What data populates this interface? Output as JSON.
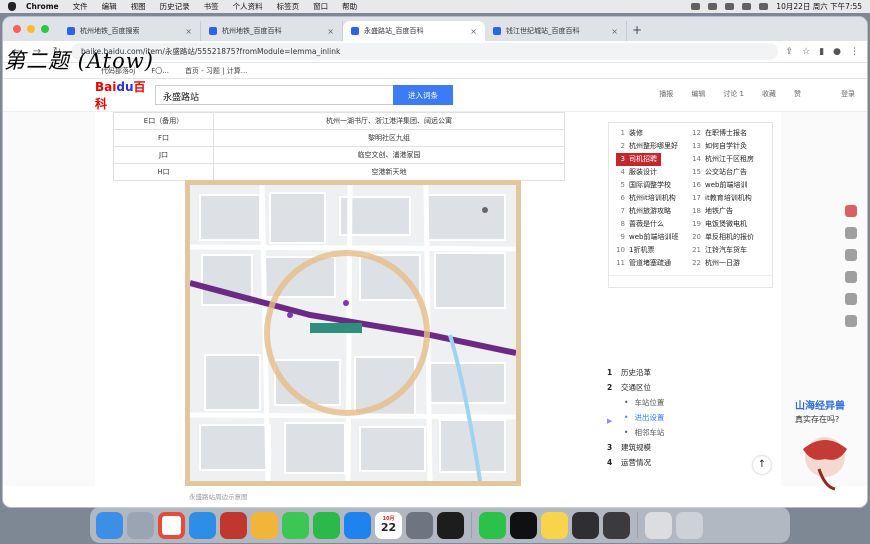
{
  "menubar": {
    "app": "Chrome",
    "items": [
      "文件",
      "编辑",
      "视图",
      "历史记录",
      "书签",
      "个人资料",
      "标签页",
      "窗口",
      "帮助"
    ],
    "clock": "10月22日 周六 下午7:55"
  },
  "tabs": [
    {
      "title": "杭州地铁_百度搜索",
      "active": false
    },
    {
      "title": "杭州地铁_百度百科",
      "active": false
    },
    {
      "title": "永盛路站_百度百科",
      "active": true
    },
    {
      "title": "钱江世纪城站_百度百科",
      "active": false
    }
  ],
  "address": {
    "url": "baike.baidu.com/item/永盛路站/55521875?fromModule=lemma_inlink"
  },
  "bookmarks": [
    "代码部落oj",
    "F〇...",
    "首页 - 习题 | 计算..."
  ],
  "overlay_note": "第二题 (Atow)",
  "baike": {
    "logo": {
      "part1": "Bai",
      "part2": "du",
      "part3": "百科"
    },
    "search_value": "永盛路站",
    "search_button": "进入词条",
    "actions": [
      "播报",
      "编辑",
      "讨论 1",
      "收藏",
      "赞"
    ],
    "login": "登录"
  },
  "exits_table": [
    {
      "exit": "E口（备用）",
      "destination": "杭州一湖书厅、浙江港洋集团、阔远公寓"
    },
    {
      "exit": "F口",
      "destination": "黎明社区九组"
    },
    {
      "exit": "J口",
      "destination": "临空文创、浦港家园"
    },
    {
      "exit": "H口",
      "destination": "空港新天地"
    }
  ],
  "map": {
    "caption": "永盛路站周边示意图"
  },
  "hot_list": {
    "left": [
      {
        "n": "1",
        "text": "装修"
      },
      {
        "n": "2",
        "text": "杭州整形哪里好"
      },
      {
        "n": "3",
        "text": "司机招聘",
        "selected": true
      },
      {
        "n": "4",
        "text": "服装设计"
      },
      {
        "n": "5",
        "text": "国际调整学校"
      },
      {
        "n": "6",
        "text": "杭州it培训机构"
      },
      {
        "n": "7",
        "text": "杭州旅游攻略"
      },
      {
        "n": "8",
        "text": "蔷薇是什么"
      },
      {
        "n": "9",
        "text": "web前端培训班"
      },
      {
        "n": "10",
        "text": "1折机票"
      },
      {
        "n": "11",
        "text": "管道堵塞疏通"
      }
    ],
    "right": [
      {
        "n": "12",
        "text": "在职博士报名"
      },
      {
        "n": "13",
        "text": "如何自学针灸"
      },
      {
        "n": "14",
        "text": "杭州江干区租房"
      },
      {
        "n": "15",
        "text": "公交站台广告"
      },
      {
        "n": "16",
        "text": "web前端培训"
      },
      {
        "n": "17",
        "text": "it教育培训机构"
      },
      {
        "n": "18",
        "text": "地铁广告"
      },
      {
        "n": "19",
        "text": "电饭煲微电机"
      },
      {
        "n": "20",
        "text": "单反相机的报价"
      },
      {
        "n": "21",
        "text": "江铃汽车货车"
      },
      {
        "n": "22",
        "text": "杭州一日游"
      }
    ]
  },
  "toc": [
    {
      "n": "1",
      "text": "历史沿革"
    },
    {
      "n": "2",
      "text": "交通区位"
    },
    {
      "sub": true,
      "text": "车站位置"
    },
    {
      "sub": true,
      "text": "进出设置",
      "current": true
    },
    {
      "sub": true,
      "text": "相邻车站"
    },
    {
      "n": "3",
      "text": "建筑规模"
    },
    {
      "n": "4",
      "text": "运营情况"
    }
  ],
  "promo": {
    "title": "山海经异兽",
    "subtitle": "真实存在吗?"
  },
  "dock": {
    "calendar_month": "10月",
    "calendar_day": "22",
    "apps": [
      "finder",
      "launchpad",
      "chrome",
      "mail",
      "photo-booth",
      "photos",
      "messages",
      "facetime",
      "app-store",
      "calendar",
      "system-preferences",
      "terminal",
      "wechat",
      "qq",
      "notes",
      "obs",
      "record",
      "preview",
      "trash"
    ]
  },
  "colors": {
    "accent": "#3b7cf5",
    "selected": "#c1272d",
    "brand_red": "#e10602",
    "brand_blue": "#2932e1"
  }
}
